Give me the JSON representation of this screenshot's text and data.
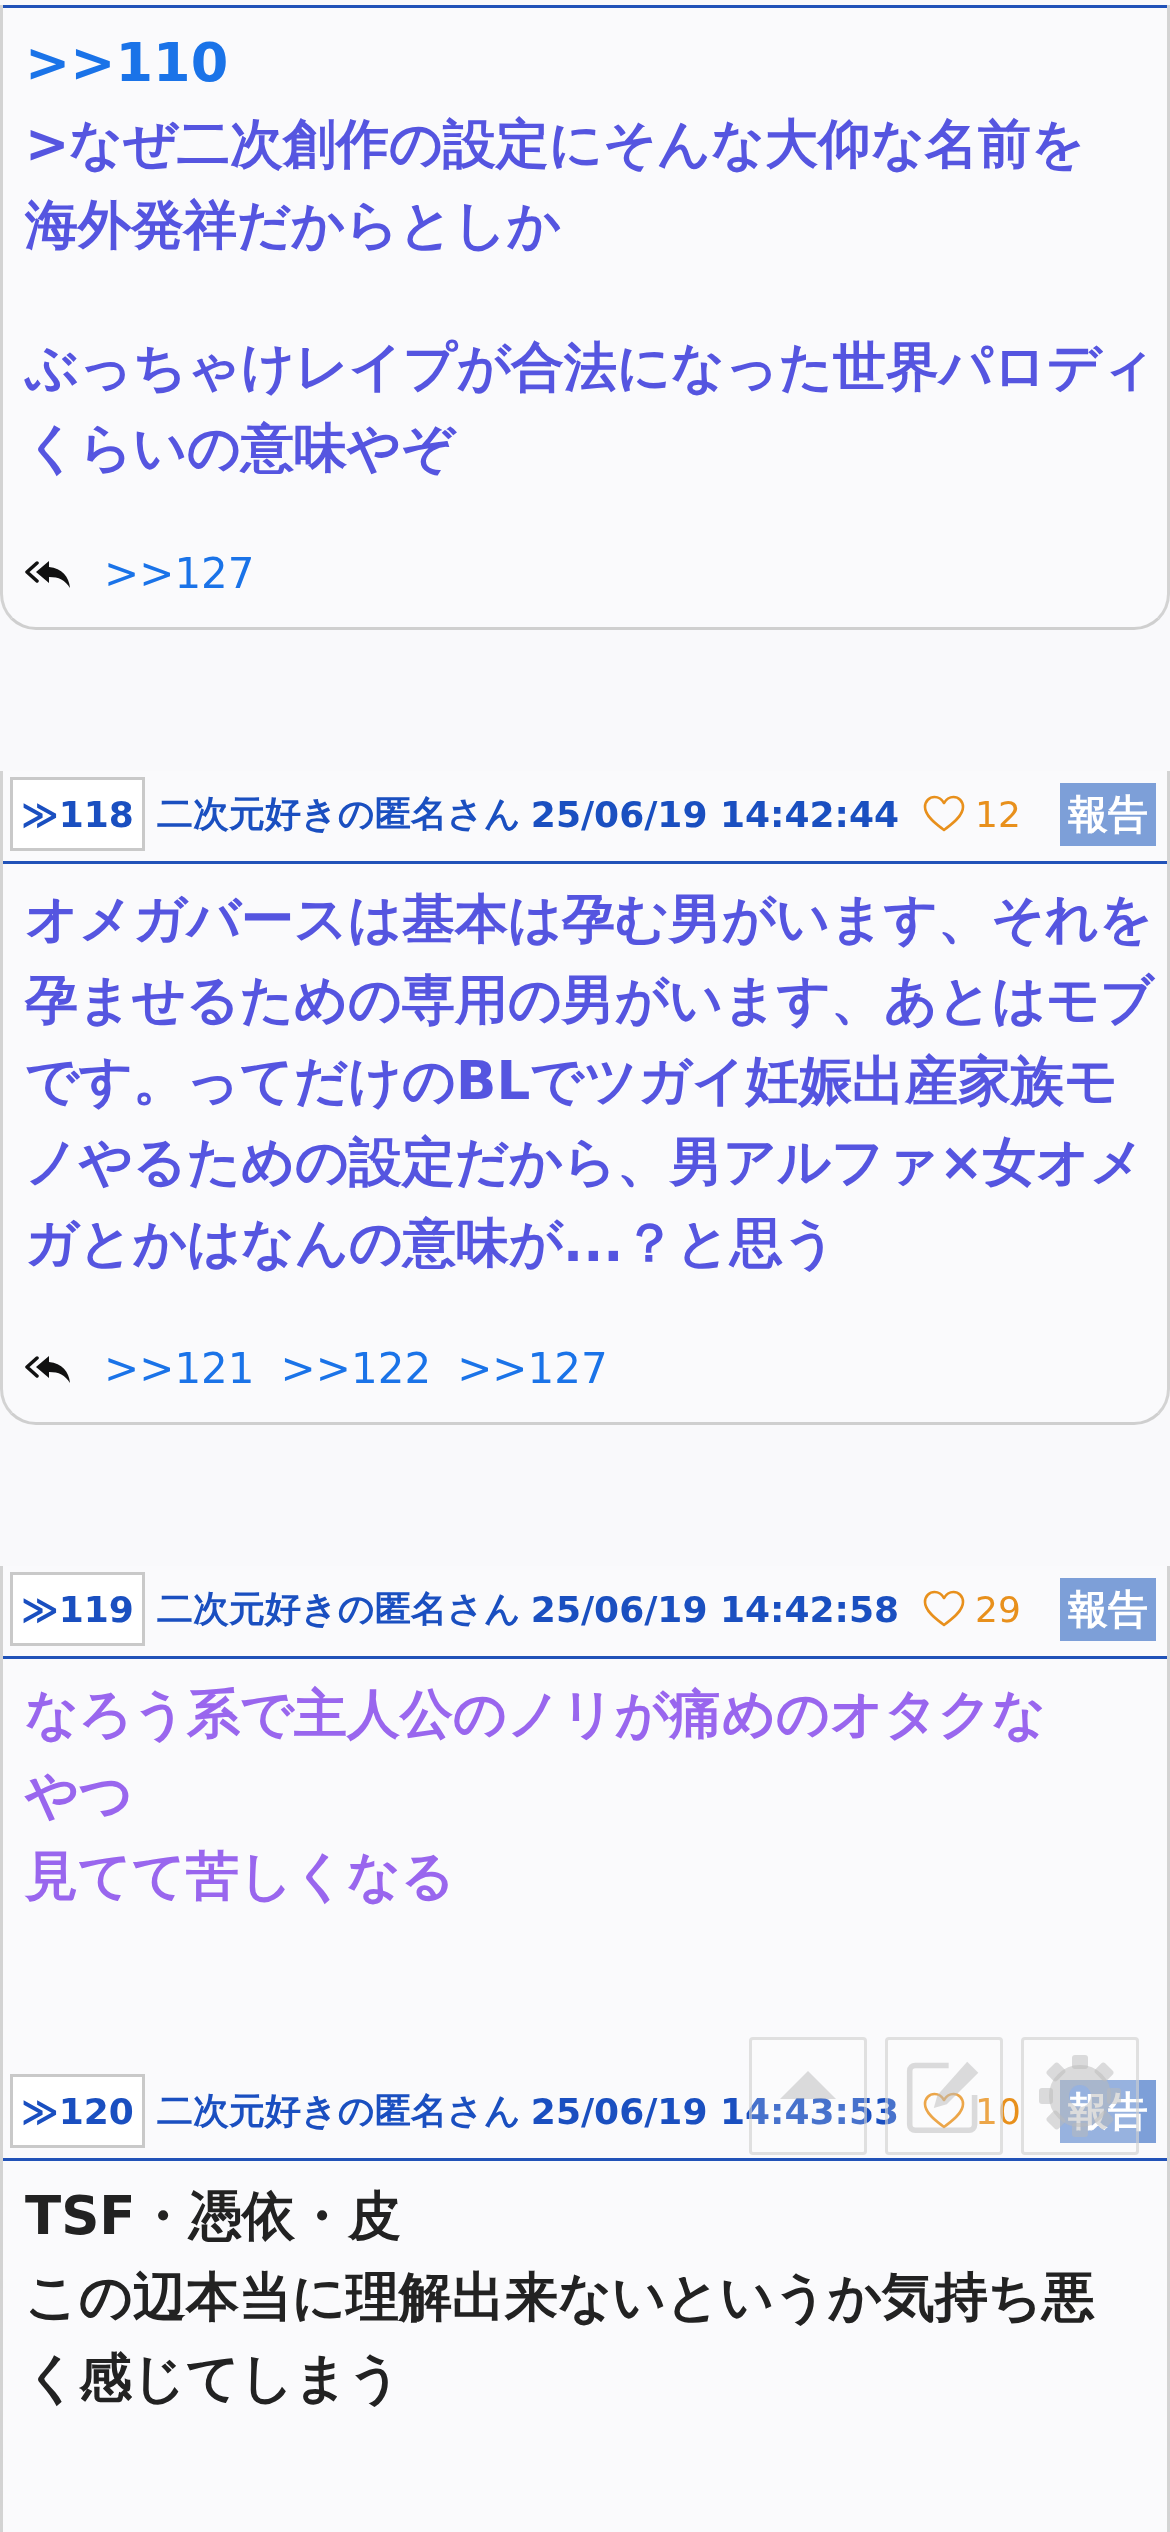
{
  "posts": [
    {
      "anchor": ">>110",
      "color": "#5555e0",
      "paragraphs": [
        {
          "lines": [
            ">なぜ二次創作の設定にそんな大仰な名前を",
            "海外発祥だからとしか"
          ]
        },
        {
          "lines": [
            "ぶっちゃけレイプが合法になった世界パロディくらいの意味やぞ"
          ]
        }
      ],
      "replies": [
        ">>127"
      ]
    },
    {
      "number": "≫118",
      "author": "二次元好きの匿名さん",
      "date": "25/06/19 14:42:44",
      "likes": "12",
      "report": "報告",
      "color": "#5555e0",
      "paragraphs": [
        {
          "lines": [
            "オメガバースは基本は孕む男がいます、それを孕ませるための専用の男がいます、あとはモブです。ってだけのBLでツガイ妊娠出産家族モノやるための設定だから、男アルファ×女オメガとかはなんの意味が...？と思う"
          ]
        }
      ],
      "replies": [
        ">>121",
        ">>122",
        ">>127"
      ]
    },
    {
      "number": "≫119",
      "author": "二次元好きの匿名さん",
      "date": "25/06/19 14:42:58",
      "likes": "29",
      "report": "報告",
      "color": "#9966ee",
      "paragraphs": [
        {
          "lines": [
            "なろう系で主人公のノリが痛めのオタクな",
            "やつ",
            "見てて苦しくなる"
          ]
        }
      ]
    },
    {
      "number": "≫120",
      "author": "二次元好きの匿名さん",
      "date": "25/06/19 14:43:53",
      "likes": "10",
      "report": "報告",
      "color": "#222222",
      "paragraphs": [
        {
          "lines": [
            "TSF・憑依・皮",
            "この辺本当に理解出来ないというか気持ち悪",
            "く感じてしまう"
          ]
        }
      ]
    }
  ],
  "floating_buttons": [
    {
      "kind": "top"
    },
    {
      "kind": "edit"
    },
    {
      "kind": "settings"
    }
  ]
}
